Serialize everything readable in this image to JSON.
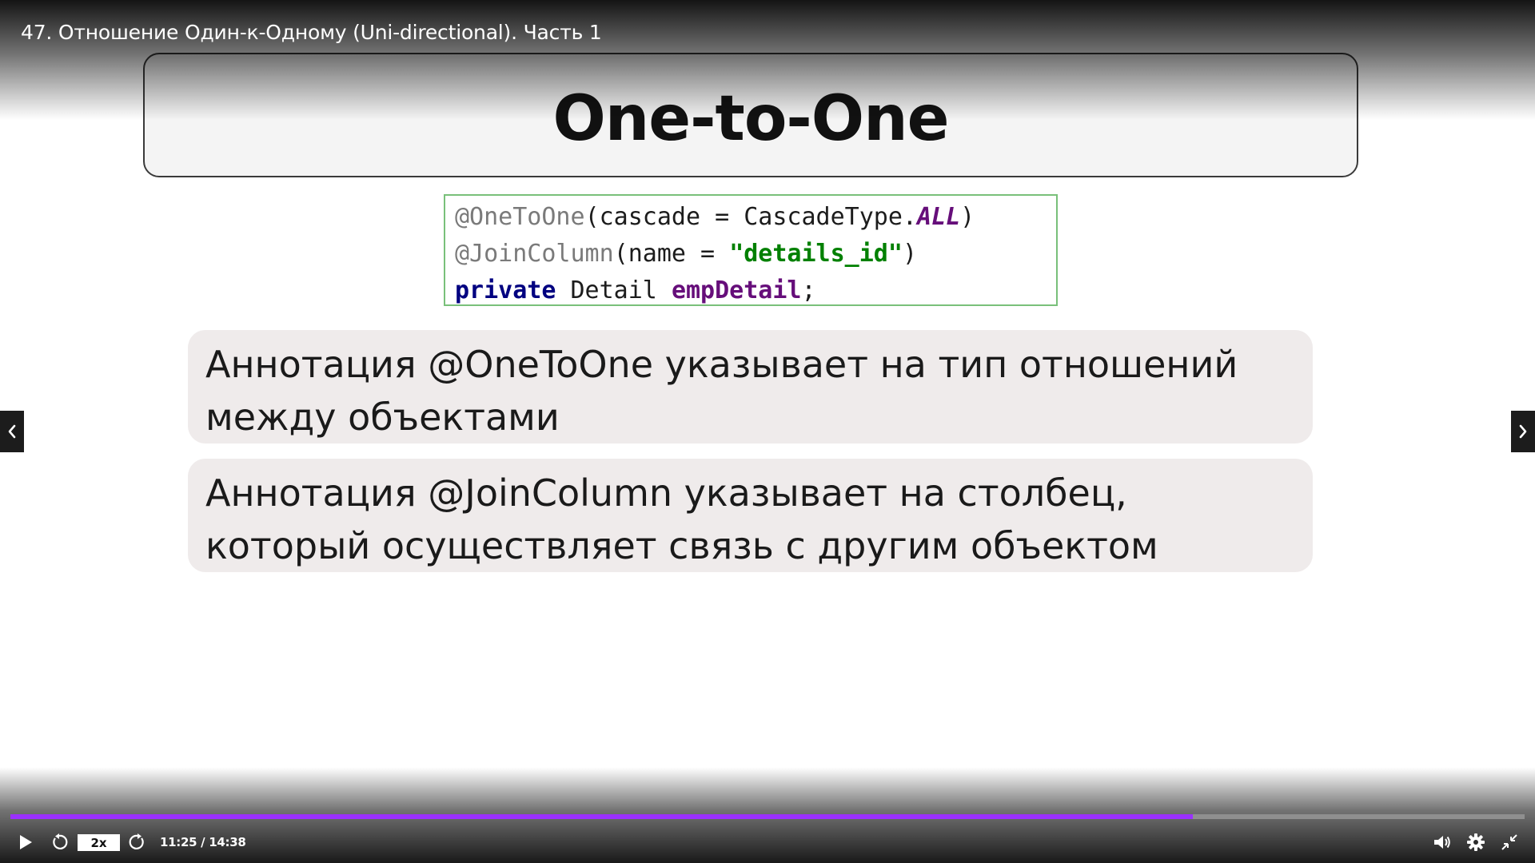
{
  "player": {
    "video_title": "47. Отношение Один-к-Одному (Uni-directional). Часть 1",
    "speed_label": "2x",
    "time_current": "11:25",
    "time_separator": " / ",
    "time_total": "14:38",
    "progress_fraction": 0.781,
    "accent_color": "#9b30ff",
    "icons": {
      "play": "play-icon",
      "rewind": "rewind-icon",
      "forward": "forward-icon",
      "volume": "volume-icon",
      "settings": "gear-icon",
      "exit_fullscreen": "exit-fullscreen-icon",
      "prev": "chevron-left-icon",
      "next": "chevron-right-icon"
    }
  },
  "slide": {
    "title": "One-to-One",
    "code": {
      "line1": {
        "annotation": "@OneToOne",
        "open": "(cascade = CascadeType.",
        "constant": "ALL",
        "close": ")"
      },
      "line2": {
        "annotation": "@JoinColumn",
        "open": "(name = ",
        "string": "\"details_id\"",
        "close": ")"
      },
      "line3": {
        "keyword": "private",
        "type": " Detail ",
        "field": "empDetail",
        "end": ";"
      }
    },
    "bullets": [
      "Аннотация @OneToOne указывает на тип отношений между объектами",
      "Аннотация @JoinColumn указывает на столбец, который осуществляет связь с другим объектом"
    ]
  }
}
